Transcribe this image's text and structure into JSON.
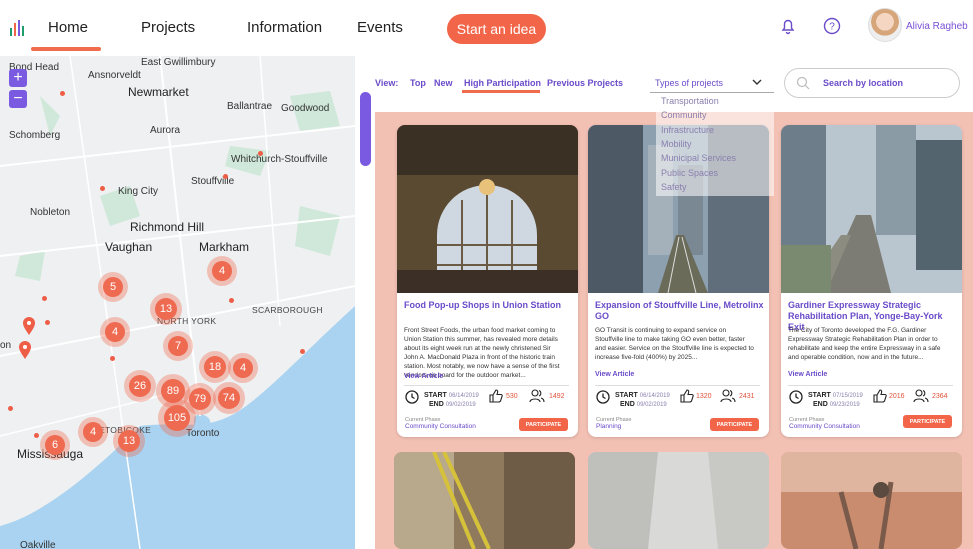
{
  "header": {
    "nav": [
      "Home",
      "Projects",
      "Information",
      "Events"
    ],
    "cta": "Start an idea",
    "user_name": "Alivia Ragheb",
    "icons": [
      "logo-icon",
      "bell-icon",
      "help-icon"
    ]
  },
  "map": {
    "zoom_in": "+",
    "zoom_out": "−",
    "cities": [
      "Bond Head",
      "East Gwillimbury",
      "Ansnorveldt",
      "Newmarket",
      "Ballantrae",
      "Goodwood",
      "Schomberg",
      "Aurora",
      "Whitchurch-Stouffville",
      "Stouffville",
      "King City",
      "Nobleton",
      "Richmond Hill",
      "Vaughan",
      "Markham",
      "NORTH YORK",
      "SCARBOROUGH",
      "ETOBICOKE",
      "Toronto",
      "Mississauga",
      "Oakville",
      "on"
    ],
    "clusters": [
      5,
      13,
      4,
      4,
      7,
      26,
      89,
      18,
      4,
      79,
      74,
      105,
      4,
      13,
      6
    ]
  },
  "filters": {
    "label": "View:",
    "options": [
      "Top",
      "New",
      "High Participation",
      "Previous Projects"
    ],
    "active": "High Participation"
  },
  "types": {
    "label": "Types of projects",
    "items": [
      "Transportation",
      "Community",
      "Infrastructure",
      "Mobility",
      "Municipal Services",
      "Public Spaces",
      "Safety"
    ]
  },
  "search": {
    "placeholder": "Search by location"
  },
  "cards": [
    {
      "title": "Food Pop-up Shops in Union Station",
      "desc": "Front Street Foods, the urban food market coming to Union Station this summer, has revealed more details about its eight week run at the newly christened Sir John A. MacDonald Plaza in front of the historic train station. Most notably, we now have a sense of the first vendors on board for the outdoor market...",
      "view": "View Article",
      "start_label": "START",
      "start": "06/14/2019",
      "end_label": "END",
      "end": "09/02/2019",
      "likes": "530",
      "participants": "1492",
      "phase_label": "Current Phase",
      "phase": "Community Consultation",
      "button": "PARTICIPATE"
    },
    {
      "title": "Expansion of Stouffville Line, Metrolinx GO",
      "desc": "GO Transit is continuing to expand service on Stouffville line to make taking GO even better, faster and easier. Service on the Stouffville line is expected to increase five-fold (400%) by 2025...",
      "view": "View Article",
      "start_label": "START",
      "start": "06/14/2019",
      "end_label": "END",
      "end": "09/02/2019",
      "likes": "1320",
      "participants": "2431",
      "phase_label": "Current Phase",
      "phase": "Planning",
      "button": "PARTICIPATE"
    },
    {
      "title": "Gardiner Expressway Strategic Rehabilitation Plan, Yonge-Bay-York Exit",
      "desc": "The City of Toronto developed the F.G. Gardiner Expressway Strategic Rehabilitation Plan in order to rehabilitate and keep the entire Expressway in a safe and operable condition, now and in the future...",
      "view": "View Article",
      "start_label": "START",
      "start": "07/15/2019",
      "end_label": "END",
      "end": "09/23/2019",
      "likes": "2016",
      "participants": "2364",
      "phase_label": "Current Phase",
      "phase": "Community Consultation",
      "button": "PARTICIPATE"
    }
  ],
  "colors": {
    "accent": "#f26548",
    "purple": "#6a4bc9",
    "panel_bg": "#f3c0b4",
    "map_water": "#a9d3f0",
    "map_green": "#b9e0c8"
  }
}
